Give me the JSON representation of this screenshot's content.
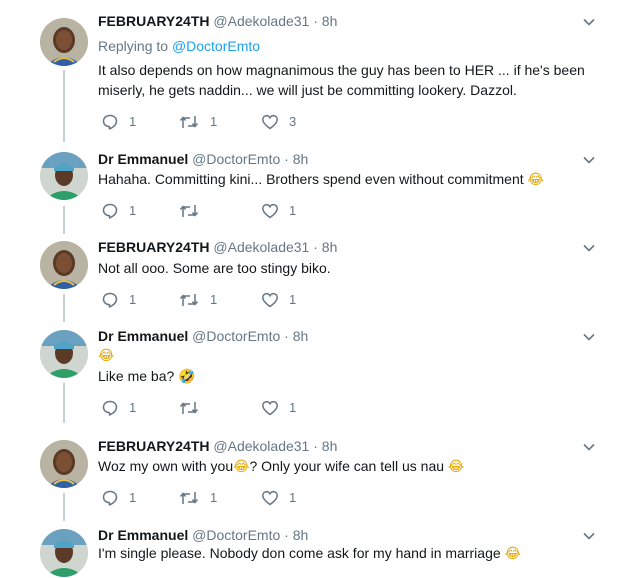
{
  "tweets": [
    {
      "name": "FEBRUARY24TH",
      "handle": "@Adekolade31",
      "time": "8h",
      "replying_label": "Replying to",
      "replying_to": "@DoctorEmto",
      "text": "It also depends on how magnanimous the guy has been to HER ... if he's been miserly, he gets naddin... we will just be committing lookery. Dazzol.",
      "replies": "1",
      "retweets": "1",
      "likes": "3"
    },
    {
      "name": "Dr Emmanuel",
      "handle": "@DoctorEmto",
      "time": "8h",
      "text": "Hahaha. Committing kini... Brothers spend even without commitment",
      "emoji_end": "😂",
      "replies": "1",
      "retweets": "",
      "likes": "1"
    },
    {
      "name": "FEBRUARY24TH",
      "handle": "@Adekolade31",
      "time": "8h",
      "text": "Not all ooo. Some are too stingy biko.",
      "replies": "1",
      "retweets": "1",
      "likes": "1"
    },
    {
      "name": "Dr Emmanuel",
      "handle": "@DoctorEmto",
      "time": "8h",
      "line1_emoji": "😂",
      "text": "Like me ba?",
      "emoji_end": "🤣",
      "replies": "1",
      "retweets": "",
      "likes": "1"
    },
    {
      "name": "FEBRUARY24TH",
      "handle": "@Adekolade31",
      "time": "8h",
      "text_a": "Woz my own with you",
      "emoji_mid": "😂",
      "text_b": "? Only your wife can tell us nau",
      "emoji_end": "😂",
      "replies": "1",
      "retweets": "1",
      "likes": "1"
    },
    {
      "name": "Dr Emmanuel",
      "handle": "@DoctorEmto",
      "time": "8h",
      "text": "I'm single please. Nobody don come ask for my hand in marriage",
      "emoji_end": "😂"
    }
  ],
  "separator": "·",
  "colors": {
    "link": "#1da1f2",
    "muted": "#657786",
    "thread_line": "#c4cfd6"
  }
}
